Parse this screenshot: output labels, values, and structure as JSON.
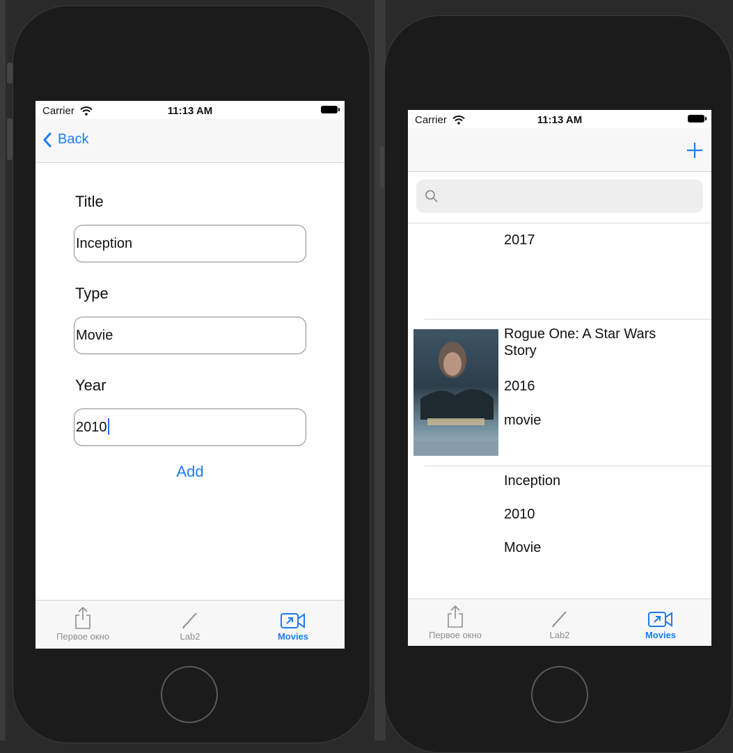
{
  "left_phone": {
    "status": {
      "carrier": "Carrier",
      "time": "11:13 AM"
    },
    "nav": {
      "back_label": "Back"
    },
    "form": {
      "title_label": "Title",
      "title_value": "Inception",
      "type_label": "Type",
      "type_value": "Movie",
      "year_label": "Year",
      "year_value": "2010",
      "add_label": "Add"
    },
    "tabs": [
      {
        "label": "Первое окно",
        "icon": "share-icon",
        "active": false
      },
      {
        "label": "Lab2",
        "icon": "pencil-icon",
        "active": false
      },
      {
        "label": "Movies",
        "icon": "video-camera-icon",
        "active": true
      }
    ]
  },
  "right_phone": {
    "status": {
      "carrier": "Carrier",
      "time": "11:13 AM"
    },
    "nav": {
      "add_icon": "plus-icon"
    },
    "search": {
      "placeholder": "",
      "icon": "search-icon"
    },
    "movies": [
      {
        "title": "",
        "year": "2017",
        "type": ""
      },
      {
        "title": "Rogue One: A Star Wars Story",
        "year": "2016",
        "type": "movie",
        "poster": "poster-image"
      },
      {
        "title": "Inception",
        "year": "2010",
        "type": "Movie"
      }
    ],
    "tabs": [
      {
        "label": "Первое окно",
        "icon": "share-icon",
        "active": false
      },
      {
        "label": "Lab2",
        "icon": "pencil-icon",
        "active": false
      },
      {
        "label": "Movies",
        "icon": "video-camera-icon",
        "active": true
      }
    ]
  },
  "colors": {
    "accent": "#1a7cf5",
    "device": "#1b1b1b",
    "background": "#2a2a2a"
  }
}
